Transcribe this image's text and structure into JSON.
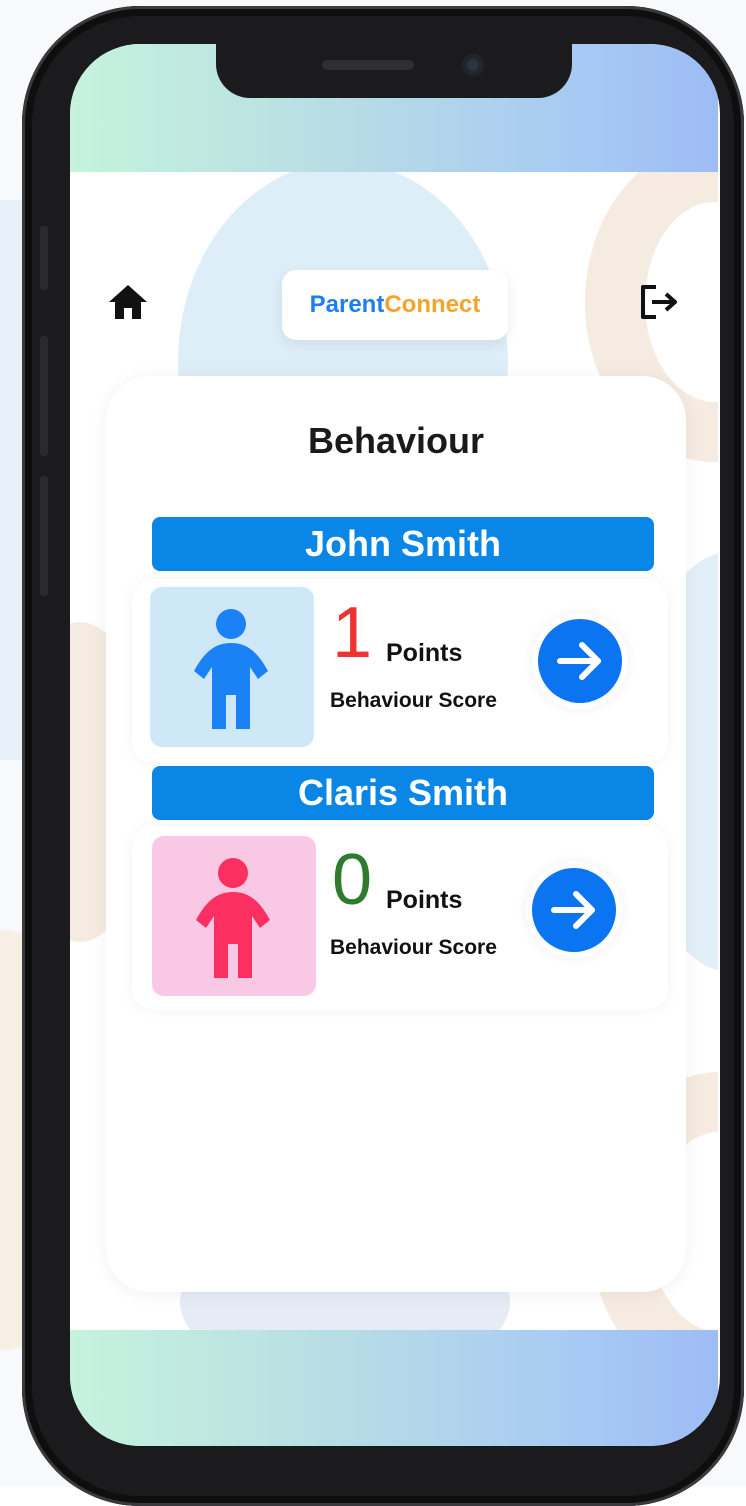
{
  "app": {
    "logo_part1": "Parent",
    "logo_part2": "Connect",
    "logo_colors": {
      "part1": "#1e7ef0",
      "part2": "#f6a32a"
    }
  },
  "header": {
    "home_icon": "home-icon",
    "logout_icon": "logout-icon"
  },
  "page": {
    "title": "Behaviour"
  },
  "children": [
    {
      "name": "John Smith",
      "score": "1",
      "score_color": "#ef3333",
      "points_label": "Points",
      "score_label": "Behaviour Score",
      "avatar_bg": "#cfe8f8",
      "avatar_color": "#1a82f5",
      "icon": "child-icon"
    },
    {
      "name": "Claris Smith",
      "score": "0",
      "score_color": "#2e7a2e",
      "points_label": "Points",
      "score_label": "Behaviour Score",
      "avatar_bg": "#f9c8e4",
      "avatar_color": "#fb3060",
      "icon": "child-icon"
    }
  ],
  "accent": {
    "name_bar": "#0a86e6",
    "button": "#0b74f0"
  }
}
